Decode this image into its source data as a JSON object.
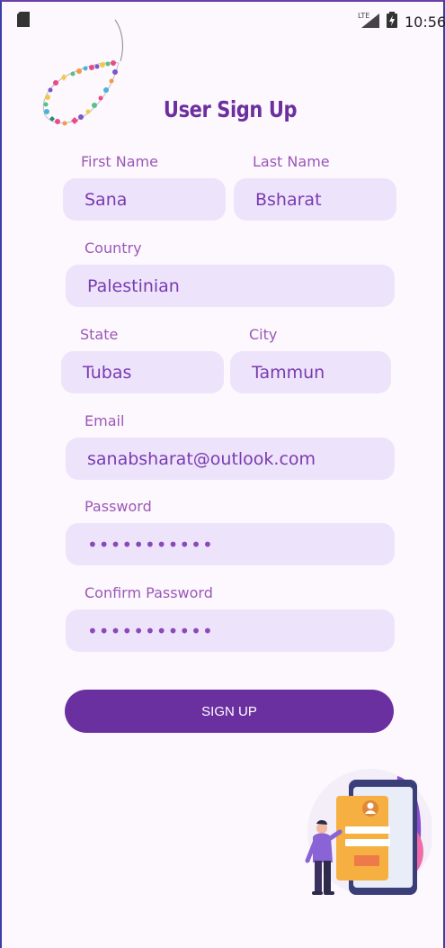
{
  "status_bar": {
    "time": "10:56",
    "network": "LTE"
  },
  "title": "User Sign Up",
  "form": {
    "first_name": {
      "label": "First Name",
      "value": "Sana"
    },
    "last_name": {
      "label": "Last Name",
      "value": "Bsharat"
    },
    "country": {
      "label": "Country",
      "value": "Palestinian"
    },
    "state": {
      "label": "State",
      "value": "Tubas"
    },
    "city": {
      "label": "City",
      "value": "Tammun"
    },
    "email": {
      "label": "Email",
      "value": "sanabsharat@outlook.com"
    },
    "password": {
      "label": "Password",
      "value": "•••••••••••"
    },
    "confirm_password": {
      "label": "Confirm Password",
      "value": "•••••••••••"
    }
  },
  "signup_label": "SIGN UP",
  "colors": {
    "accent": "#6b30a0",
    "field_bg": "#ede4fb",
    "label": "#9a58b8",
    "background": "#fdf8fd"
  },
  "icons": [
    "sd-card-icon",
    "lte-signal-icon",
    "battery-icon",
    "bracelet-decoration",
    "signup-illustration"
  ]
}
